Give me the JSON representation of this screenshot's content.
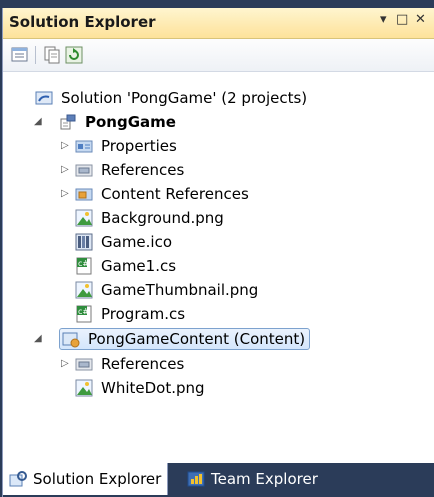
{
  "window": {
    "title": "Solution Explorer",
    "pin_glyph": "▾",
    "maximize_glyph": "□",
    "close_glyph": "✕"
  },
  "toolbar": {
    "buttons": [
      "properties-icon",
      "show-all-files-icon",
      "refresh-icon"
    ]
  },
  "tree": {
    "solution": "Solution 'PongGame' (2 projects)",
    "project1": {
      "name": "PongGame",
      "items": [
        {
          "label": "Properties",
          "icon": "properties-folder-icon"
        },
        {
          "label": "References",
          "icon": "references-icon"
        },
        {
          "label": "Content References",
          "icon": "content-references-icon"
        },
        {
          "label": "Background.png",
          "icon": "image-file-icon"
        },
        {
          "label": "Game.ico",
          "icon": "ico-file-icon"
        },
        {
          "label": "Game1.cs",
          "icon": "csharp-file-icon"
        },
        {
          "label": "GameThumbnail.png",
          "icon": "image-file-icon"
        },
        {
          "label": "Program.cs",
          "icon": "csharp-file-icon"
        }
      ]
    },
    "project2": {
      "name": "PongGameContent (Content)",
      "items": [
        {
          "label": "References",
          "icon": "references-icon"
        },
        {
          "label": "WhiteDot.png",
          "icon": "image-file-icon"
        }
      ]
    }
  },
  "tabs": {
    "solution_explorer": "Solution Explorer",
    "team_explorer": "Team Explorer"
  },
  "colors": {
    "title_gradient_top": "#fff5cf",
    "title_gradient_bottom": "#fde29a",
    "dock_background": "#2b3c59",
    "selection_border": "#7da2ce"
  }
}
